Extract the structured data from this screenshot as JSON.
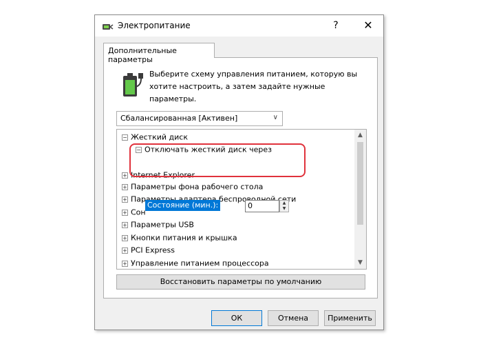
{
  "window": {
    "title": "Электропитание",
    "help_glyph": "?",
    "close_glyph": "✕"
  },
  "tab": {
    "label": "Дополнительные параметры"
  },
  "description": "Выберите схему управления питанием, которую вы хотите настроить, а затем задайте нужные параметры.",
  "plan_combo": {
    "selected": "Сбалансированная [Активен]"
  },
  "tree": {
    "items": [
      {
        "label": "Жесткий диск",
        "expander": "⊟"
      },
      {
        "label": "Отключать жесткий диск через",
        "expander": "⊟"
      },
      {
        "label": "Internet Explorer",
        "expander": "⊞"
      },
      {
        "label": "Параметры фона рабочего стола",
        "expander": "⊞"
      },
      {
        "label": "Параметры адаптера беспроводной сети",
        "expander": "⊞"
      },
      {
        "label": "Сон",
        "expander": "⊞"
      },
      {
        "label": "Параметры USB",
        "expander": "⊞"
      },
      {
        "label": "Кнопки питания и крышка",
        "expander": "⊞"
      },
      {
        "label": "PCI Express",
        "expander": "⊞"
      },
      {
        "label": "Управление питанием процессора",
        "expander": "⊞"
      }
    ],
    "setting": {
      "label": "Состояние (мин.):",
      "value": "0"
    }
  },
  "buttons": {
    "restore": "Восстановить параметры по умолчанию",
    "ok": "ОК",
    "cancel": "Отмена",
    "apply": "Применить"
  },
  "colors": {
    "highlight_ring": "#e0313b",
    "selection": "#0078d7"
  }
}
